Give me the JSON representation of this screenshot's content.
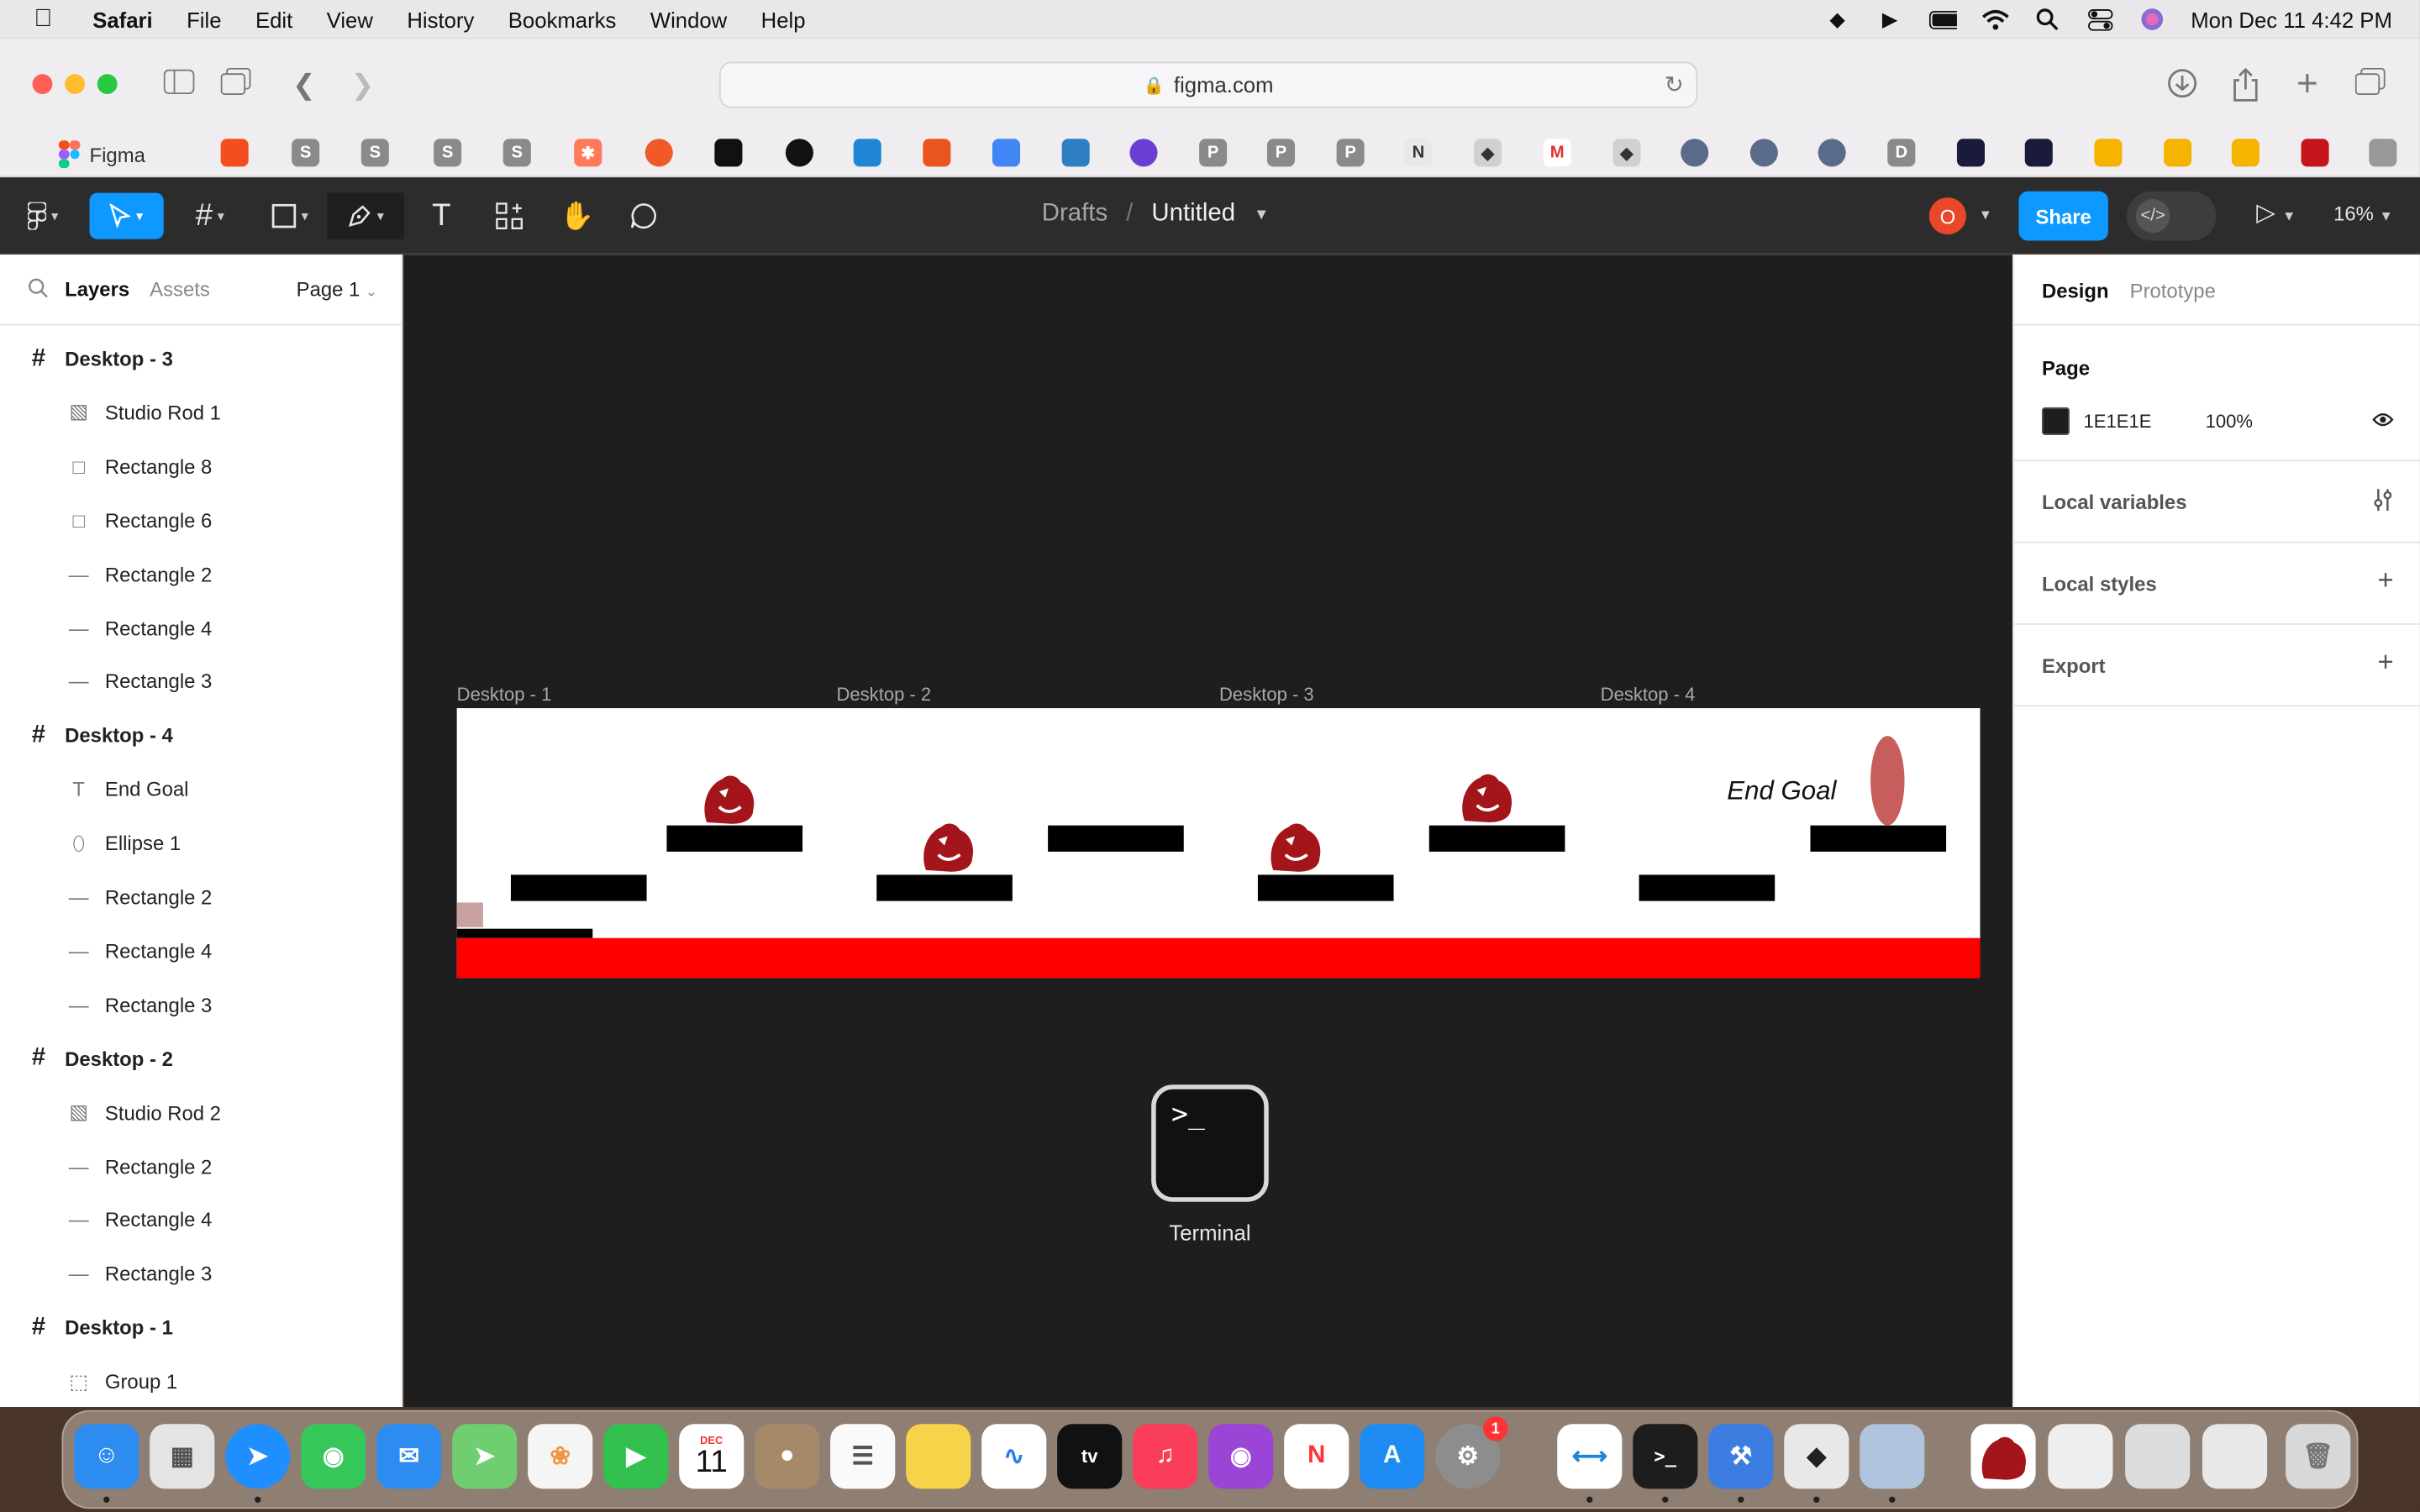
{
  "menubar": {
    "app": "Safari",
    "items": [
      "File",
      "Edit",
      "View",
      "History",
      "Bookmarks",
      "Window",
      "Help"
    ],
    "datetime": "Mon Dec 11  4:42 PM"
  },
  "browser": {
    "url": "figma.com",
    "active_tab": "Figma"
  },
  "toolbar": {
    "breadcrumb_parent": "Drafts",
    "breadcrumb_sep": "/",
    "file_name": "Untitled",
    "avatar_letter": "O",
    "share_label": "Share",
    "devmode_glyph": "</>",
    "zoom": "16%"
  },
  "left_panel": {
    "tab_layers": "Layers",
    "tab_assets": "Assets",
    "page_selector": "Page 1",
    "layers": [
      {
        "name": "Desktop - 3",
        "kind": "frame"
      },
      {
        "name": "Studio Rod 1",
        "kind": "image"
      },
      {
        "name": "Rectangle 8",
        "kind": "rect"
      },
      {
        "name": "Rectangle 6",
        "kind": "rect"
      },
      {
        "name": "Rectangle 2",
        "kind": "line"
      },
      {
        "name": "Rectangle 4",
        "kind": "line"
      },
      {
        "name": "Rectangle 3",
        "kind": "line"
      },
      {
        "name": "Desktop - 4",
        "kind": "frame"
      },
      {
        "name": "End Goal",
        "kind": "text"
      },
      {
        "name": "Ellipse 1",
        "kind": "ellipse"
      },
      {
        "name": "Rectangle 2",
        "kind": "line"
      },
      {
        "name": "Rectangle 4",
        "kind": "line"
      },
      {
        "name": "Rectangle 3",
        "kind": "line"
      },
      {
        "name": "Desktop - 2",
        "kind": "frame"
      },
      {
        "name": "Studio Rod 2",
        "kind": "image"
      },
      {
        "name": "Rectangle 2",
        "kind": "line"
      },
      {
        "name": "Rectangle 4",
        "kind": "line"
      },
      {
        "name": "Rectangle 3",
        "kind": "line"
      },
      {
        "name": "Desktop - 1",
        "kind": "frame"
      },
      {
        "name": "Group 1",
        "kind": "group"
      }
    ]
  },
  "canvas": {
    "frame_labels": [
      "Desktop - 1",
      "Desktop - 2",
      "Desktop - 3",
      "Desktop - 4"
    ],
    "end_goal_text": "End Goal",
    "terminal_label": "Terminal",
    "terminal_prompt": ">_",
    "help_glyph": "?"
  },
  "right_panel": {
    "tab_design": "Design",
    "tab_prototype": "Prototype",
    "page_heading": "Page",
    "page_color_hex": "1E1E1E",
    "page_opacity": "100%",
    "local_variables": "Local variables",
    "local_styles": "Local styles",
    "export": "Export"
  },
  "dock": {
    "calendar_month": "DEC",
    "calendar_day": "11",
    "settings_badge": "1"
  }
}
